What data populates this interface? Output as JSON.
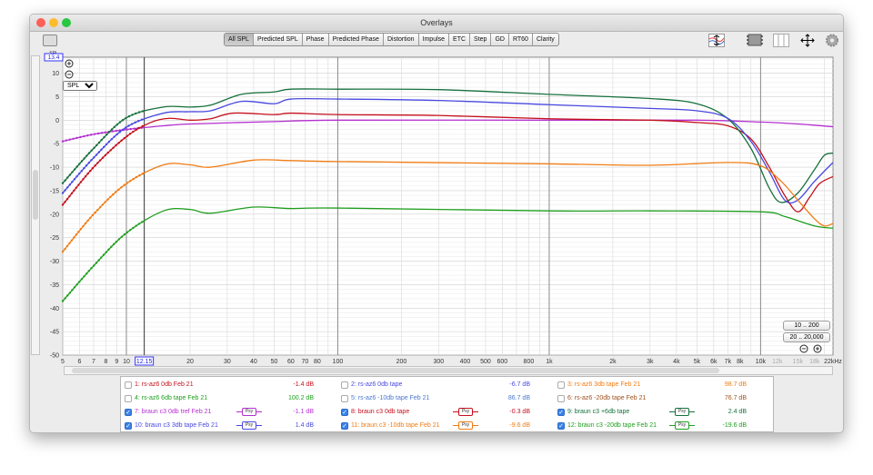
{
  "window": {
    "title": "Overlays"
  },
  "tabs": [
    {
      "label": "All SPL",
      "active": true
    },
    {
      "label": "Predicted SPL"
    },
    {
      "label": "Phase"
    },
    {
      "label": "Predicted Phase"
    },
    {
      "label": "Distortion"
    },
    {
      "label": "Impulse"
    },
    {
      "label": "ETC"
    },
    {
      "label": "Step"
    },
    {
      "label": "GD"
    },
    {
      "label": "RT60"
    },
    {
      "label": "Clarity"
    }
  ],
  "plot": {
    "y_axis_label": "SPL",
    "y_cursor_value": "13.4",
    "y_ticks": [
      "10",
      "5",
      "0",
      "-5",
      "-10",
      "-15",
      "-20",
      "-25",
      "-30",
      "-35",
      "-40",
      "-45",
      "-50"
    ],
    "y_range": [
      -50,
      13.4
    ],
    "x_range_hz": [
      5,
      22000
    ],
    "x_ticks": [
      {
        "f": 5,
        "l": "5"
      },
      {
        "f": 6,
        "l": "6"
      },
      {
        "f": 7,
        "l": "7"
      },
      {
        "f": 8,
        "l": "8"
      },
      {
        "f": 9,
        "l": "9"
      },
      {
        "f": 10,
        "l": "10"
      },
      {
        "f": 20,
        "l": "20"
      },
      {
        "f": 30,
        "l": "30"
      },
      {
        "f": 40,
        "l": "40"
      },
      {
        "f": 50,
        "l": "50"
      },
      {
        "f": 60,
        "l": "60"
      },
      {
        "f": 70,
        "l": "70"
      },
      {
        "f": 80,
        "l": "80"
      },
      {
        "f": 100,
        "l": "100"
      },
      {
        "f": 200,
        "l": "200"
      },
      {
        "f": 300,
        "l": "300"
      },
      {
        "f": 400,
        "l": "400"
      },
      {
        "f": 500,
        "l": "500"
      },
      {
        "f": 600,
        "l": "600"
      },
      {
        "f": 800,
        "l": "800"
      },
      {
        "f": 1000,
        "l": "1k"
      },
      {
        "f": 2000,
        "l": "2k"
      },
      {
        "f": 3000,
        "l": "3k"
      },
      {
        "f": 4000,
        "l": "4k"
      },
      {
        "f": 5000,
        "l": "5k"
      },
      {
        "f": 6000,
        "l": "6k"
      },
      {
        "f": 7000,
        "l": "7k"
      },
      {
        "f": 8000,
        "l": "8k"
      },
      {
        "f": 10000,
        "l": "10k"
      },
      {
        "f": 12000,
        "l": "12k",
        "dim": true
      },
      {
        "f": 15000,
        "l": "15k",
        "dim": true
      },
      {
        "f": 18000,
        "l": "18k",
        "dim": true
      },
      {
        "f": 22000,
        "l": "22kHz"
      }
    ],
    "x_cursor_value": "12.15",
    "x_cursor_hz": 12.15,
    "measurement_select": "SPL",
    "range_buttons": [
      "10 .. 200",
      "20 .. 20,000"
    ]
  },
  "chart_data": {
    "type": "line",
    "xlabel": "Hz",
    "ylabel": "SPL (dB)",
    "xscale": "log",
    "xlim": [
      5,
      22000
    ],
    "ylim": [
      -50,
      13.4
    ],
    "series": [
      {
        "name": "7: braun c3 0db tref Feb 21",
        "color": "#b52fd0",
        "points": [
          [
            5,
            -4.5
          ],
          [
            7,
            -3
          ],
          [
            10,
            -2
          ],
          [
            15,
            -1.2
          ],
          [
            20,
            -0.8
          ],
          [
            50,
            -0.3
          ],
          [
            100,
            0
          ],
          [
            1000,
            0
          ],
          [
            5000,
            0
          ],
          [
            10000,
            -0.4
          ],
          [
            15000,
            -0.8
          ],
          [
            22000,
            -1.4
          ]
        ]
      },
      {
        "name": "8: braun c3 0db tape",
        "color": "#c4101c",
        "points": [
          [
            5,
            -18
          ],
          [
            7,
            -10
          ],
          [
            10,
            -3.5
          ],
          [
            13,
            -0.5
          ],
          [
            16,
            0.4
          ],
          [
            20,
            0
          ],
          [
            25,
            0.3
          ],
          [
            32,
            1.5
          ],
          [
            50,
            1.2
          ],
          [
            60,
            1.5
          ],
          [
            100,
            1.2
          ],
          [
            300,
            1
          ],
          [
            1000,
            0.3
          ],
          [
            3000,
            0
          ],
          [
            5000,
            -0.5
          ],
          [
            7000,
            -1.2
          ],
          [
            9000,
            -4
          ],
          [
            11000,
            -10
          ],
          [
            13000,
            -16
          ],
          [
            15000,
            -19.5
          ],
          [
            17000,
            -16.5
          ],
          [
            19000,
            -13.5
          ],
          [
            22000,
            -12
          ]
        ]
      },
      {
        "name": "9: braun c3 +6db tape",
        "color": "#16703c",
        "points": [
          [
            5,
            -13.4
          ],
          [
            7,
            -6
          ],
          [
            10,
            0.5
          ],
          [
            15,
            2.8
          ],
          [
            20,
            2.8
          ],
          [
            25,
            3.2
          ],
          [
            35,
            5.5
          ],
          [
            50,
            6
          ],
          [
            60,
            6.6
          ],
          [
            100,
            6.6
          ],
          [
            300,
            6.5
          ],
          [
            1000,
            5.5
          ],
          [
            3000,
            4.6
          ],
          [
            5000,
            3.5
          ],
          [
            7000,
            0.3
          ],
          [
            9000,
            -6
          ],
          [
            11000,
            -14.5
          ],
          [
            12500,
            -17.5
          ],
          [
            15000,
            -15.5
          ],
          [
            18000,
            -10.5
          ],
          [
            20000,
            -7.5
          ],
          [
            22000,
            -7
          ]
        ]
      },
      {
        "name": "10: braun c3 3db tape Feb 21",
        "color": "#4848e0",
        "points": [
          [
            5,
            -15.5
          ],
          [
            7,
            -8
          ],
          [
            10,
            -1.5
          ],
          [
            15,
            1.5
          ],
          [
            20,
            1.8
          ],
          [
            25,
            2
          ],
          [
            35,
            4
          ],
          [
            50,
            3.5
          ],
          [
            60,
            4.5
          ],
          [
            100,
            4.5
          ],
          [
            300,
            4.2
          ],
          [
            1000,
            3.3
          ],
          [
            3000,
            2.5
          ],
          [
            5000,
            2
          ],
          [
            7000,
            0.4
          ],
          [
            9000,
            -4.5
          ],
          [
            11000,
            -11
          ],
          [
            13000,
            -17
          ],
          [
            15000,
            -17
          ],
          [
            18000,
            -13
          ],
          [
            22000,
            -9
          ]
        ]
      },
      {
        "name": "11: braun c3 -10db tape Feb 21",
        "color": "#f07c14",
        "points": [
          [
            5,
            -28
          ],
          [
            7,
            -20
          ],
          [
            10,
            -13.5
          ],
          [
            15,
            -9.5
          ],
          [
            20,
            -9.5
          ],
          [
            25,
            -10
          ],
          [
            40,
            -8.5
          ],
          [
            60,
            -8.6
          ],
          [
            100,
            -8.8
          ],
          [
            1000,
            -9.3
          ],
          [
            3000,
            -9.6
          ],
          [
            7000,
            -9
          ],
          [
            10000,
            -9.7
          ],
          [
            12500,
            -13
          ],
          [
            15000,
            -17
          ],
          [
            18000,
            -21
          ],
          [
            20000,
            -22.5
          ],
          [
            22000,
            -22
          ]
        ]
      },
      {
        "name": "12: braun c3 -20db tape Feb 21",
        "color": "#1e9e1e",
        "points": [
          [
            5,
            -38.5
          ],
          [
            7,
            -31
          ],
          [
            10,
            -24
          ],
          [
            15,
            -19.3
          ],
          [
            20,
            -19
          ],
          [
            25,
            -19.8
          ],
          [
            40,
            -18.5
          ],
          [
            60,
            -18.8
          ],
          [
            100,
            -18.7
          ],
          [
            1000,
            -19.3
          ],
          [
            3000,
            -19.3
          ],
          [
            10000,
            -19.5
          ],
          [
            13000,
            -20.5
          ],
          [
            18000,
            -22.5
          ],
          [
            22000,
            -23
          ]
        ]
      }
    ]
  },
  "legend": [
    {
      "label": "1: rs-az6 0db Feb 21",
      "value": "-1.4 dB",
      "color": "#c4101c",
      "checked": false
    },
    {
      "label": "2: rs-az6 0db tape",
      "value": "-6.7 dB",
      "color": "#4848e0",
      "checked": false
    },
    {
      "label": "3: rs-az6 3db tape Feb 21",
      "value": "98.7 dB",
      "color": "#f07c14",
      "checked": false
    },
    {
      "label": "4: rs-az6 6db tape Feb 21",
      "value": "100.2 dB",
      "color": "#1e9e1e",
      "checked": false
    },
    {
      "label": "5: rs-az6 -10db tape Feb 21",
      "value": "86.7 dB",
      "color": "#4a78d0",
      "checked": false
    },
    {
      "label": "6: rs-az6 -20db tape Feb 21",
      "value": "76.7 dB",
      "color": "#a0501e",
      "checked": false
    },
    {
      "label": "7: braun c3 0db tref Feb 21",
      "value": "-1.1 dB",
      "color": "#b52fd0",
      "checked": true,
      "psy": "Psy"
    },
    {
      "label": "8: braun c3 0db tape",
      "value": "-0.3 dB",
      "color": "#c4101c",
      "checked": true,
      "psy": "Psy"
    },
    {
      "label": "9: braun c3 +6db tape",
      "value": "2.4 dB",
      "color": "#16703c",
      "checked": true,
      "psy": "Psy"
    },
    {
      "label": "10: braun c3 3db tape Feb 21",
      "value": "1.4 dB",
      "color": "#4848e0",
      "checked": true,
      "psy": "Psy"
    },
    {
      "label": "11: braun c3 -10db tape Feb 21",
      "value": "-9.6 dB",
      "color": "#f07c14",
      "checked": true,
      "psy": "Psy"
    },
    {
      "label": "12: braun c3 -20db tape Feb 21",
      "value": "-19.6 dB",
      "color": "#1e9e1e",
      "checked": true,
      "psy": "Psy"
    }
  ]
}
